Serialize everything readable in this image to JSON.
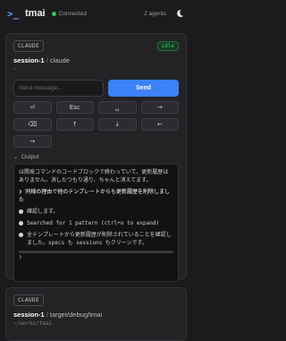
{
  "topbar": {
    "logo": ">_",
    "app_name": "tmai",
    "status": "Connected",
    "agents": "2 agents"
  },
  "colors": {
    "accent": "#3b82f6",
    "connected": "#3fbf5a",
    "idle": "#3fd06a"
  },
  "sessions": [
    {
      "agent": "CLAUDE",
      "state": "idle",
      "name": "session-1",
      "path": "claude",
      "cwd": "~",
      "input_placeholder": "Send message...",
      "send_label": "Send",
      "keys": [
        "⏎",
        "Esc",
        "␣",
        "→",
        "⌫",
        "↑",
        "↓",
        "←",
        "→"
      ],
      "output_label": "Output",
      "output_lines": [
        "は開発コマンドのコードブロックで終わっていて、更新履歴はありません。消したつもり通り、ちゃんと消えてます。",
        "❯ 同様の理由で他のテンプレートからも更新履歴を削除しました",
        "確認します。",
        "Searched for 1 pattern (ctrl+o to expand)",
        "全テンプレートから更新履歴が削除されていることを確認しました。specs も sessions もクリーンです。",
        "❯"
      ]
    },
    {
      "agent": "CLAUDE",
      "name": "session-1",
      "path": "target/debug/tmai",
      "cwd": "~/works/tmai"
    }
  ]
}
